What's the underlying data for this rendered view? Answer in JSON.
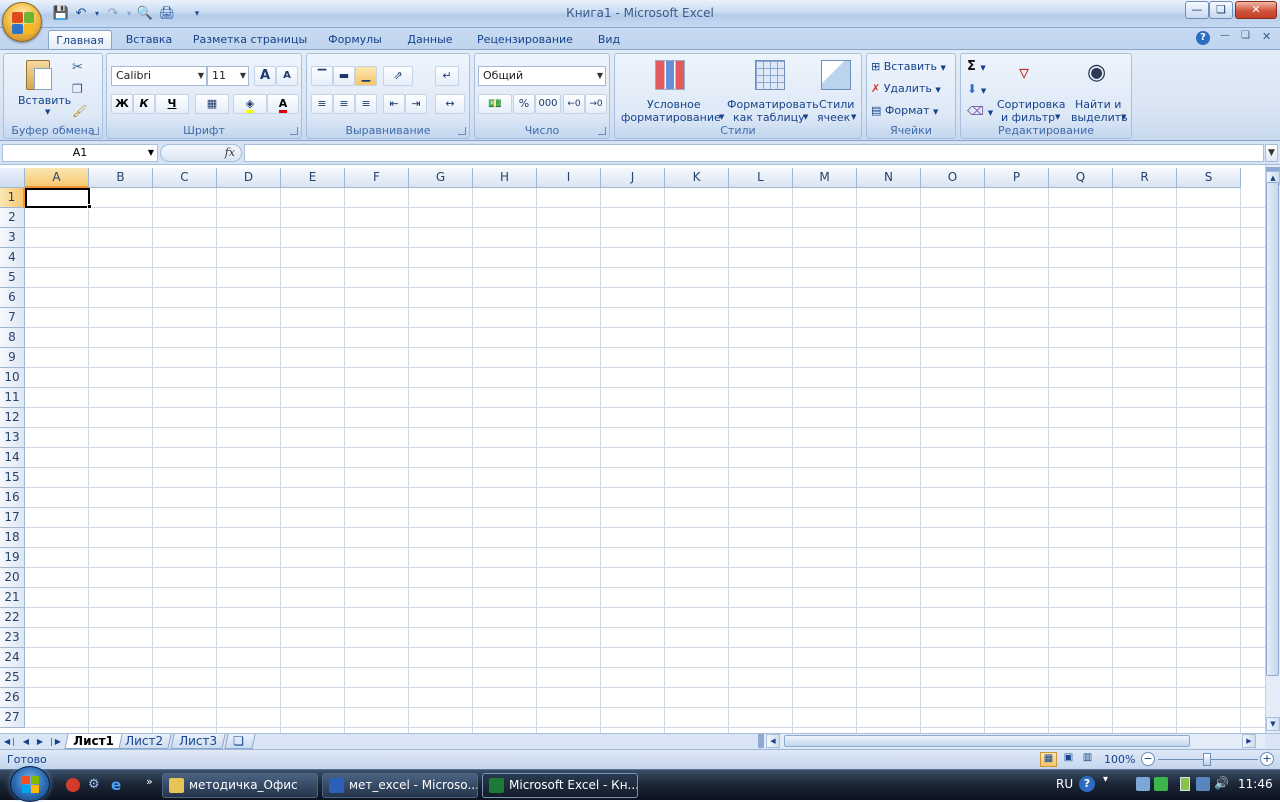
{
  "window": {
    "title": "Книга1 - Microsoft Excel"
  },
  "tabs": [
    "Главная",
    "Вставка",
    "Разметка страницы",
    "Формулы",
    "Данные",
    "Рецензирование",
    "Вид"
  ],
  "ribbon": {
    "clipboard": {
      "label": "Буфер обмена",
      "paste": "Вставить"
    },
    "font": {
      "label": "Шрифт",
      "name": "Calibri",
      "size": "11",
      "bold": "Ж",
      "italic": "К",
      "underline": "Ч",
      "grow": "A",
      "shrink": "A",
      "font_color_letter": "A"
    },
    "alignment": {
      "label": "Выравнивание"
    },
    "number": {
      "label": "Число",
      "format": "Общий",
      "percent": "%",
      "thousands": "000"
    },
    "styles": {
      "label": "Стили",
      "conditional_l1": "Условное",
      "conditional_l2": "форматирование",
      "table_l1": "Форматировать",
      "table_l2": "как таблицу",
      "cell_l1": "Стили",
      "cell_l2": "ячеек"
    },
    "cells": {
      "label": "Ячейки",
      "insert": "Вставить",
      "delete": "Удалить",
      "format": "Формат"
    },
    "editing": {
      "label": "Редактирование",
      "sort_l1": "Сортировка",
      "sort_l2": "и фильтр",
      "find_l1": "Найти и",
      "find_l2": "выделить",
      "sigma": "Σ"
    }
  },
  "formula_bar": {
    "name_box": "A1",
    "fx": "fx",
    "value": ""
  },
  "grid": {
    "columns": [
      "A",
      "B",
      "C",
      "D",
      "E",
      "F",
      "G",
      "H",
      "I",
      "J",
      "K",
      "L",
      "M",
      "N",
      "O",
      "P",
      "Q",
      "R",
      "S"
    ],
    "rows": [
      "1",
      "2",
      "3",
      "4",
      "5",
      "6",
      "7",
      "8",
      "9",
      "10",
      "11",
      "12",
      "13",
      "14",
      "15",
      "16",
      "17",
      "18",
      "19",
      "20",
      "21",
      "22",
      "23",
      "24",
      "25",
      "26",
      "27"
    ],
    "active_cell": "A1"
  },
  "sheets": [
    "Лист1",
    "Лист2",
    "Лист3"
  ],
  "status": {
    "ready": "Готово",
    "zoom": "100%"
  },
  "taskbar": {
    "items": [
      "методичка_Офис",
      "мет_excel - Microso...",
      "Microsoft Excel - Кн..."
    ],
    "lang": "RU",
    "clock": "11:46"
  },
  "colors": {
    "accent": "#15428b",
    "selected_header": "#f8c970",
    "ribbon_bg": "#dbe6f4"
  }
}
